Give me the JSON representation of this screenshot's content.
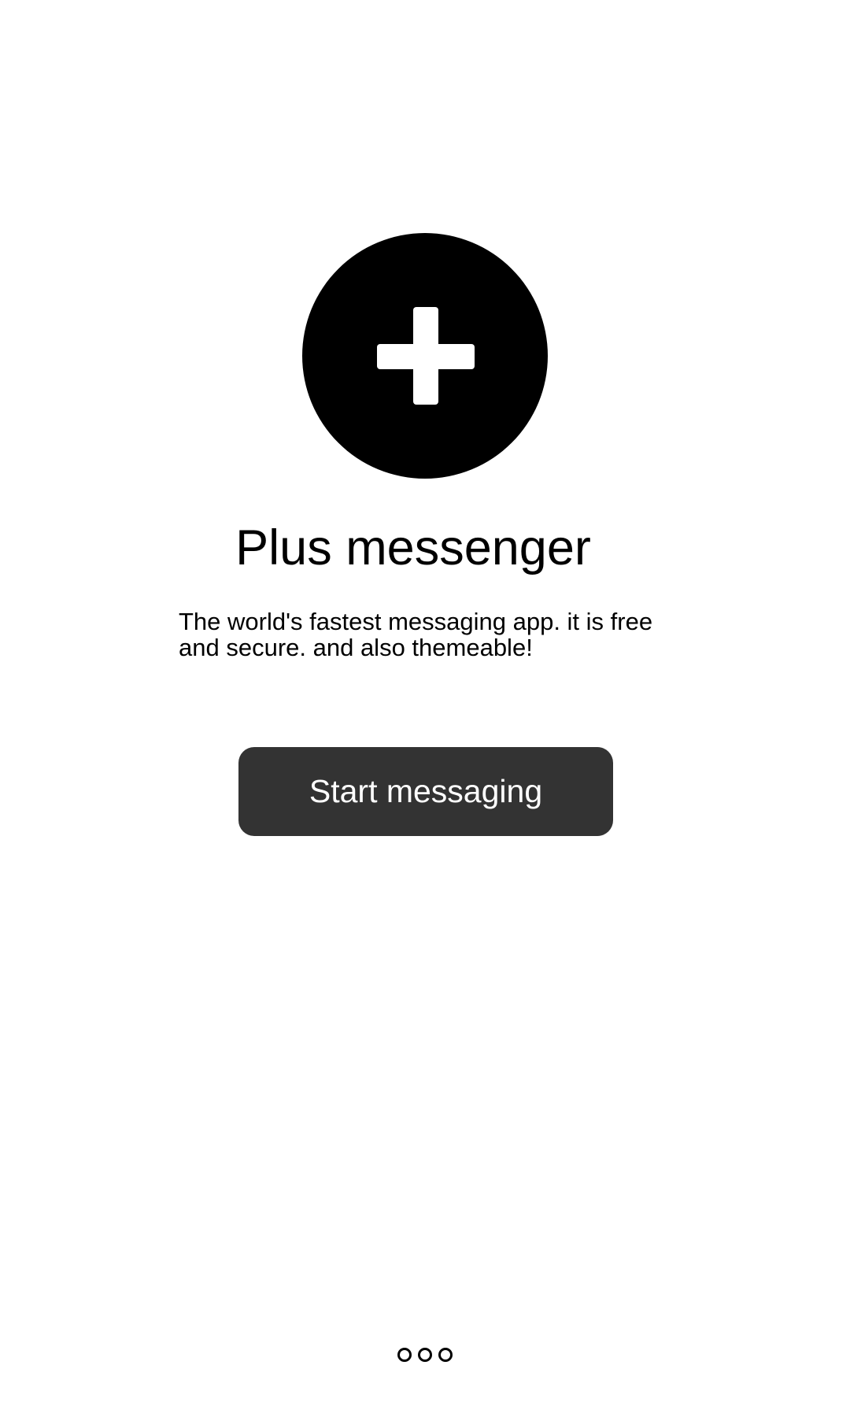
{
  "logo": {
    "icon": "plus-circle-icon",
    "circle_color": "#000000",
    "plus_color": "#ffffff"
  },
  "intro": {
    "title": "Plus messenger",
    "description": "The world's fastest messaging app. it is free and secure. and also themeable!"
  },
  "start_button": {
    "label": "Start messaging",
    "background": "#333333",
    "text_color": "#ffffff"
  },
  "pager": {
    "page_count": 3
  }
}
